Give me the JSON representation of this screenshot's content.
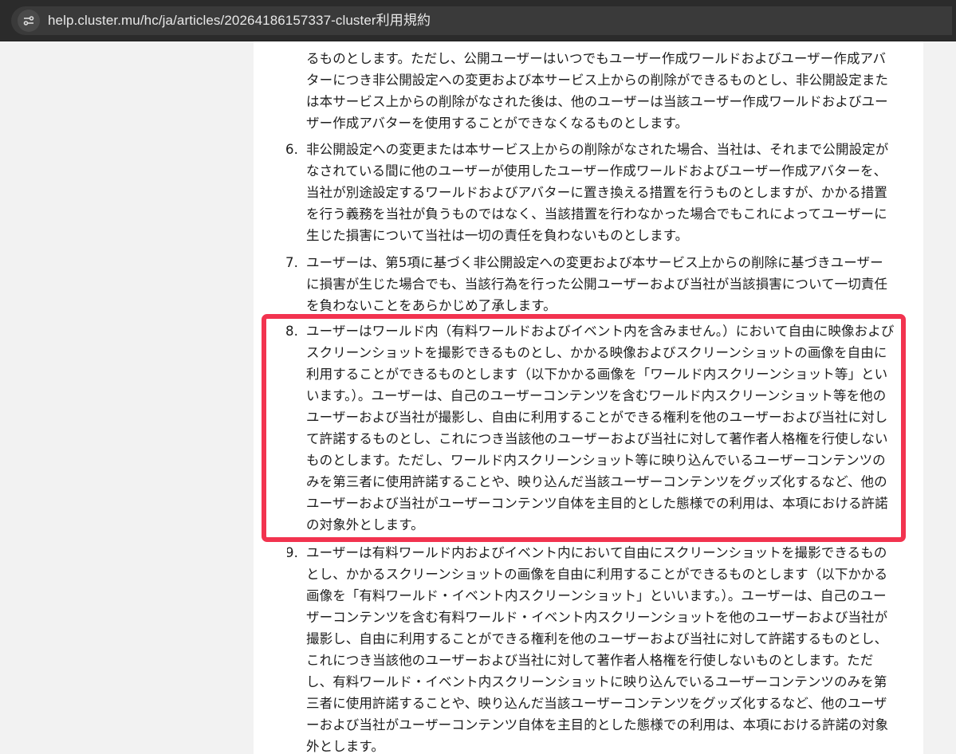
{
  "browser": {
    "url": "help.cluster.mu/hc/ja/articles/20264186157337-cluster利用規約"
  },
  "article": {
    "item5_tail": [
      "るものとします。ただし、公開ユーザーはいつでもユーザー作成ワールドおよびユーザー作成アバ",
      "ターにつき非公開設定への変更および本サービス上からの削除ができるものとし、非公開設定また",
      "は本サービス上からの削除がなされた後は、他のユーザーは当該ユーザー作成ワールドおよびユー",
      "ザー作成アバターを使用することができなくなるものとします。"
    ],
    "item6": {
      "number": "6.",
      "lines": [
        "非公開設定への変更または本サービス上からの削除がなされた場合、当社は、それまで公開設定が",
        "なされている間に他のユーザーが使用したユーザー作成ワールドおよびユーザー作成アバターを、",
        "当社が別途設定するワールドおよびアバターに置き換える措置を行うものとしますが、かかる措置",
        "を行う義務を当社が負うものではなく、当該措置を行わなかった場合でもこれによってユーザーに",
        "生じた損害について当社は一切の責任を負わないものとします。"
      ]
    },
    "item7": {
      "number": "7.",
      "lines": [
        "ユーザーは、第5項に基づく非公開設定への変更および本サービス上からの削除に基づきユーザー",
        "に損害が生じた場合でも、当該行為を行った公開ユーザーおよび当社が当該損害について一切責任",
        "を負わないことをあらかじめ了承します。"
      ]
    },
    "item8": {
      "number": "8.",
      "lines": [
        "ユーザーはワールド内（有料ワールドおよびイベント内を含みません。）において自由に映像および",
        "スクリーンショットを撮影できるものとし、かかる映像およびスクリーンショットの画像を自由に",
        "利用することができるものとします（以下かかる画像を「ワールド内スクリーンショット等」とい",
        "います。）。ユーザーは、自己のユーザーコンテンツを含むワールド内スクリーンショット等を他の",
        "ユーザーおよび当社が撮影し、自由に利用することができる権利を他のユーザーおよび当社に対し",
        "て許諾するものとし、これにつき当該他のユーザーおよび当社に対して著作者人格権を行使しない",
        "ものとします。ただし、ワールド内スクリーンショット等に映り込んでいるユーザーコンテンツの",
        "みを第三者に使用許諾することや、映り込んだ当該ユーザーコンテンツをグッズ化するなど、他の",
        "ユーザーおよび当社がユーザーコンテンツ自体を主目的とした態様での利用は、本項における許諾",
        "の対象外とします。"
      ]
    },
    "item9": {
      "number": "9.",
      "lines": [
        "ユーザーは有料ワールド内およびイベント内において自由にスクリーンショットを撮影できるもの",
        "とし、かかるスクリーンショットの画像を自由に利用することができるものとします（以下かかる",
        "画像を「有料ワールド・イベント内スクリーンショット」といいます。）。ユーザーは、自己のユー",
        "ザーコンテンツを含む有料ワールド・イベント内スクリーンショットを他のユーザーおよび当社が",
        "撮影し、自由に利用することができる権利を他のユーザーおよび当社に対して許諾するものとし、",
        "これにつき当該他のユーザーおよび当社に対して著作者人格権を行使しないものとします。ただ",
        "し、有料ワールド・イベント内スクリーンショットに映り込んでいるユーザーコンテンツのみを第",
        "三者に使用許諾することや、映り込んだ当該ユーザーコンテンツをグッズ化するなど、他のユーザ",
        "ーおよび当社がユーザーコンテンツ自体を主目的とした態様での利用は、本項における許諾の対象",
        "外とします。"
      ]
    }
  },
  "colors": {
    "highlight_border": "#f2334f",
    "browser_bar": "#2b2b2b"
  }
}
